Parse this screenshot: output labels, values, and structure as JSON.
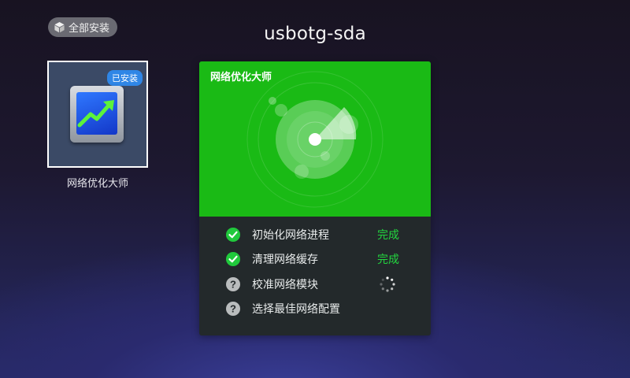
{
  "toolbar": {
    "install_all_label": "全部安装",
    "install_all_icon": "cube-icon"
  },
  "header": {
    "title": "usbotg-sda"
  },
  "app_tile": {
    "badge": "已安装",
    "name": "网络优化大师",
    "icon": "chart-up-icon"
  },
  "card": {
    "title": "网络优化大师",
    "graphic": "radar-icon",
    "tasks": [
      {
        "label": "初始化网络进程",
        "status": "done",
        "status_text": "完成",
        "icon": "check-icon"
      },
      {
        "label": "清理网络缓存",
        "status": "done",
        "status_text": "完成",
        "icon": "check-icon"
      },
      {
        "label": "校准网络模块",
        "status": "in-progress",
        "status_text": "",
        "icon": "question-icon"
      },
      {
        "label": "选择最佳网络配置",
        "status": "pending",
        "status_text": "",
        "icon": "question-icon"
      }
    ]
  },
  "colors": {
    "card_header": "#1aba15",
    "done_text": "#23d63f",
    "card_body": "#23292b",
    "badge": "#2f86e6"
  }
}
